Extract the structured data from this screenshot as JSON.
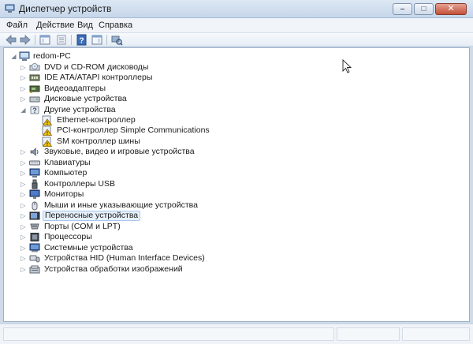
{
  "window": {
    "title": "Диспетчер устройств",
    "controls": {
      "minimize": "–",
      "maximize": "□",
      "close": "✕"
    }
  },
  "menu": [
    "Файл",
    "Действие",
    "Вид",
    "Справка"
  ],
  "toolbar": {
    "buttons": [
      "back-icon",
      "forward-icon",
      "show-hide-console-tree-icon",
      "properties-icon",
      "help-icon",
      "action-pane-icon",
      "scan-hardware-icon"
    ]
  },
  "tree": {
    "root": "redom-PC",
    "items": [
      {
        "label": "DVD и CD-ROM дисководы",
        "icon": "dvd-drive-icon",
        "expanded": false
      },
      {
        "label": "IDE ATA/ATAPI контроллеры",
        "icon": "ide-controller-icon",
        "expanded": false
      },
      {
        "label": "Видеоадаптеры",
        "icon": "display-adapter-icon",
        "expanded": false
      },
      {
        "label": "Дисковые устройства",
        "icon": "disk-drive-icon",
        "expanded": false
      },
      {
        "label": "Другие устройства",
        "icon": "other-devices-icon",
        "expanded": true,
        "children": [
          {
            "label": "Ethernet-контроллер",
            "icon": "unknown-device-warning-icon"
          },
          {
            "label": "PCI-контроллер Simple Communications",
            "icon": "unknown-device-warning-icon"
          },
          {
            "label": "SM контроллер шины",
            "icon": "unknown-device-warning-icon"
          }
        ]
      },
      {
        "label": "Звуковые, видео и игровые устройства",
        "icon": "sound-device-icon",
        "expanded": false
      },
      {
        "label": "Клавиатуры",
        "icon": "keyboard-icon",
        "expanded": false
      },
      {
        "label": "Компьютер",
        "icon": "computer-icon",
        "expanded": false
      },
      {
        "label": "Контроллеры USB",
        "icon": "usb-controller-icon",
        "expanded": false
      },
      {
        "label": "Мониторы",
        "icon": "monitor-icon",
        "expanded": false
      },
      {
        "label": "Мыши и иные указывающие устройства",
        "icon": "mouse-icon",
        "expanded": false
      },
      {
        "label": "Переносные устройства",
        "icon": "portable-device-icon",
        "expanded": false,
        "selected": true
      },
      {
        "label": "Порты (COM и LPT)",
        "icon": "port-icon",
        "expanded": false
      },
      {
        "label": "Процессоры",
        "icon": "processor-icon",
        "expanded": false
      },
      {
        "label": "Системные устройства",
        "icon": "system-device-icon",
        "expanded": false
      },
      {
        "label": "Устройства HID (Human Interface Devices)",
        "icon": "hid-device-icon",
        "expanded": false
      },
      {
        "label": "Устройства обработки изображений",
        "icon": "imaging-device-icon",
        "expanded": false
      }
    ]
  },
  "colors": {
    "warning": "#f2c200",
    "selection_bg": "#e6f0fb",
    "selection_border": "#a8c8ee"
  }
}
